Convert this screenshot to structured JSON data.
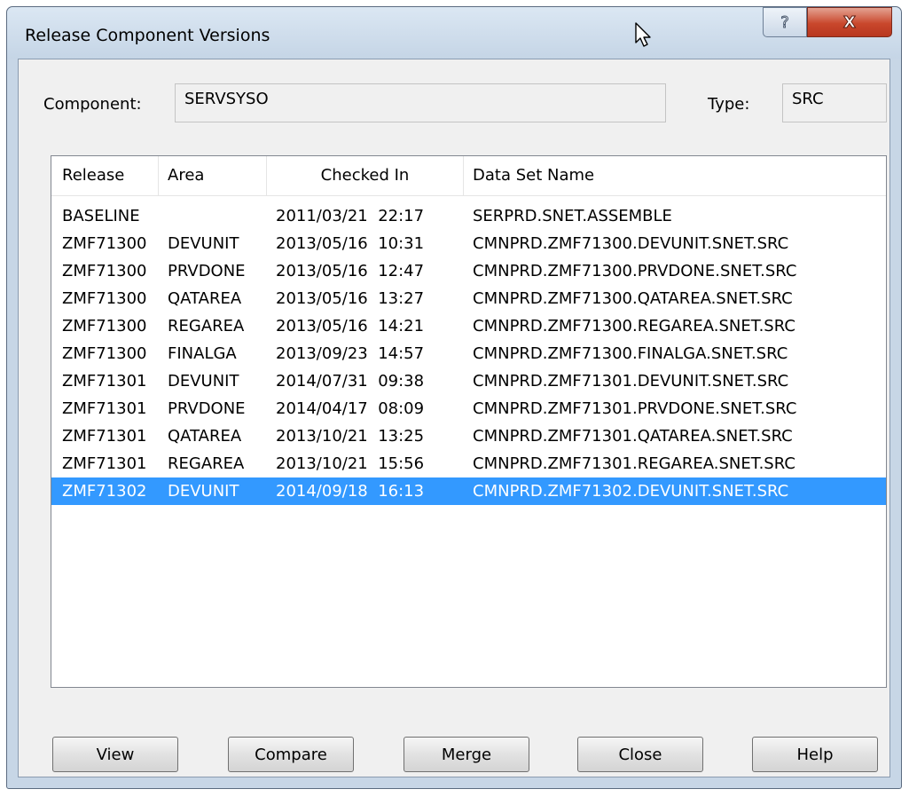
{
  "window": {
    "title": "Release Component Versions",
    "help_glyph": "?",
    "close_glyph": "X"
  },
  "component": {
    "label": "Component:",
    "value": "SERVSYSO"
  },
  "type": {
    "label": "Type:",
    "value": "SRC"
  },
  "table": {
    "columns": [
      "Release",
      "Area",
      "Checked In",
      "Data Set Name"
    ],
    "rows": [
      {
        "release": "BASELINE",
        "area": "",
        "checked_in": "2011/03/21  22:17",
        "dsn": "SERPRD.SNET.ASSEMBLE"
      },
      {
        "release": "ZMF71300",
        "area": "DEVUNIT",
        "checked_in": "2013/05/16  10:31",
        "dsn": "CMNPRD.ZMF71300.DEVUNIT.SNET.SRC"
      },
      {
        "release": "ZMF71300",
        "area": "PRVDONE",
        "checked_in": "2013/05/16  12:47",
        "dsn": "CMNPRD.ZMF71300.PRVDONE.SNET.SRC"
      },
      {
        "release": "ZMF71300",
        "area": "QATAREA",
        "checked_in": "2013/05/16  13:27",
        "dsn": "CMNPRD.ZMF71300.QATAREA.SNET.SRC"
      },
      {
        "release": "ZMF71300",
        "area": "REGAREA",
        "checked_in": "2013/05/16  14:21",
        "dsn": "CMNPRD.ZMF71300.REGAREA.SNET.SRC"
      },
      {
        "release": "ZMF71300",
        "area": "FINALGA",
        "checked_in": "2013/09/23  14:57",
        "dsn": "CMNPRD.ZMF71300.FINALGA.SNET.SRC"
      },
      {
        "release": "ZMF71301",
        "area": "DEVUNIT",
        "checked_in": "2014/07/31  09:38",
        "dsn": "CMNPRD.ZMF71301.DEVUNIT.SNET.SRC"
      },
      {
        "release": "ZMF71301",
        "area": "PRVDONE",
        "checked_in": "2014/04/17  08:09",
        "dsn": "CMNPRD.ZMF71301.PRVDONE.SNET.SRC"
      },
      {
        "release": "ZMF71301",
        "area": "QATAREA",
        "checked_in": "2013/10/21  13:25",
        "dsn": "CMNPRD.ZMF71301.QATAREA.SNET.SRC"
      },
      {
        "release": "ZMF71301",
        "area": "REGAREA",
        "checked_in": "2013/10/21  15:56",
        "dsn": "CMNPRD.ZMF71301.REGAREA.SNET.SRC"
      },
      {
        "release": "ZMF71302",
        "area": "DEVUNIT",
        "checked_in": "2014/09/18  16:13",
        "dsn": "CMNPRD.ZMF71302.DEVUNIT.SNET.SRC",
        "selected": true
      }
    ]
  },
  "buttons": {
    "view": "View",
    "compare": "Compare",
    "merge": "Merge",
    "close": "Close",
    "help": "Help"
  },
  "icons": {
    "help": "help-icon",
    "close": "close-icon",
    "cursor": "mouse-cursor-icon"
  },
  "colors": {
    "selection": "#3399ff",
    "close_button": "#c9472c"
  }
}
